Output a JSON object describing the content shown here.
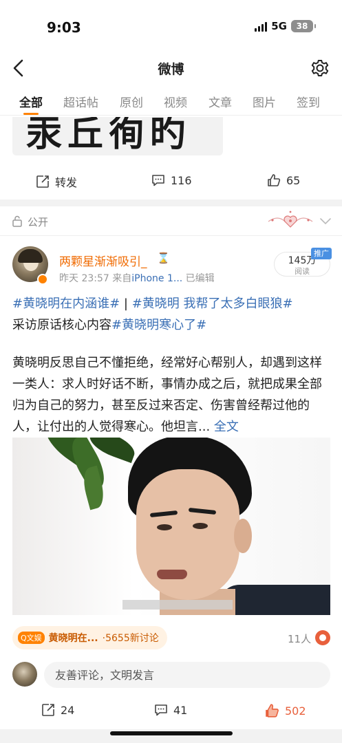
{
  "status_bar": {
    "time": "9:03",
    "network": "5G",
    "battery": "38"
  },
  "nav": {
    "title": "微博"
  },
  "tabs": [
    {
      "label": "全部",
      "active": true
    },
    {
      "label": "超话帖"
    },
    {
      "label": "原创"
    },
    {
      "label": "视频"
    },
    {
      "label": "文章"
    },
    {
      "label": "图片"
    },
    {
      "label": "签到"
    }
  ],
  "prev_post": {
    "actions": {
      "repost_label": "转发",
      "comment_count": "116",
      "like_count": "65"
    }
  },
  "visibility": {
    "label": "公开"
  },
  "post": {
    "username": "两颗星渐渐吸引_",
    "hourglass": "⌛",
    "time": "昨天 23:57",
    "source_prefix": "来自",
    "source": "iPhone 1...",
    "edited": "已编辑",
    "reads": {
      "count": "145万",
      "label": "阅读"
    },
    "promo_tag": "推广",
    "line1": {
      "topic1": "#黄晓明在内涵谁#",
      "separator": " | ",
      "topic2": "#黄晓明 我帮了太多白眼狼#"
    },
    "line2": {
      "text": "采访原话核心内容",
      "topic3": "#黄晓明寒心了#"
    },
    "body": "黄晓明反思自己不懂拒绝，经常好心帮别人，却遇到这样一类人：求人时好话不断，事情办成之后，就把成果全部归为自己的努力，甚至反过来否定、伤害曾经帮过他的人，让付出的人觉得寒心。他坦言...",
    "full_link": "全文",
    "topic_chip": {
      "tag": "Q文娱",
      "title": "黄晓明在...",
      "count": "·5655新讨论"
    },
    "people_count": "11人",
    "comment_placeholder": "友善评论，文明发言",
    "actions": {
      "repost_count": "24",
      "comment_count": "41",
      "like_count": "502"
    }
  },
  "colors": {
    "accent": "#ff8200",
    "link": "#3a6fb5",
    "like_active": "#e8603c"
  }
}
